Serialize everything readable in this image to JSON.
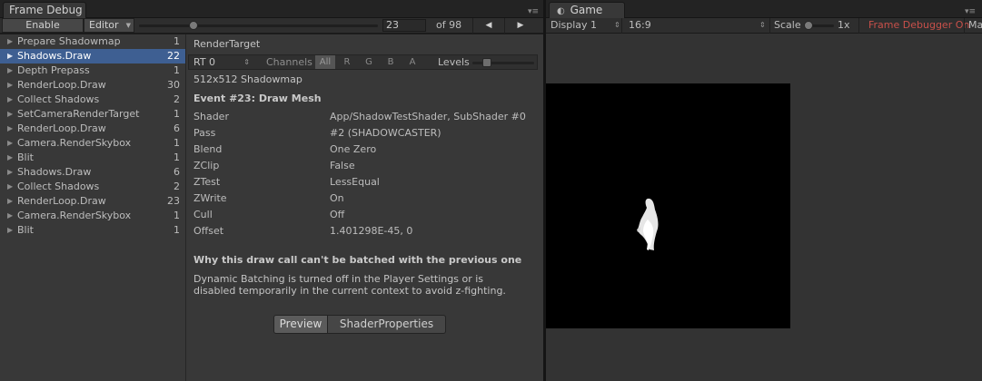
{
  "frame_debug": {
    "tab_title": "Frame Debug",
    "toolbar": {
      "enable_label": "Enable",
      "target_label": "Editor",
      "current_event": "23",
      "event_total": "of 98"
    },
    "events": [
      {
        "label": "Prepare Shadowmap",
        "count": "1"
      },
      {
        "label": "Shadows.Draw",
        "count": "22"
      },
      {
        "label": "Depth Prepass",
        "count": "1"
      },
      {
        "label": "RenderLoop.Draw",
        "count": "30"
      },
      {
        "label": "Collect Shadows",
        "count": "2"
      },
      {
        "label": "SetCameraRenderTarget",
        "count": "1"
      },
      {
        "label": "RenderLoop.Draw",
        "count": "6"
      },
      {
        "label": "Camera.RenderSkybox",
        "count": "1"
      },
      {
        "label": "Blit",
        "count": "1"
      },
      {
        "label": "Shadows.Draw",
        "count": "6"
      },
      {
        "label": "Collect Shadows",
        "count": "2"
      },
      {
        "label": "RenderLoop.Draw",
        "count": "23"
      },
      {
        "label": "Camera.RenderSkybox",
        "count": "1"
      },
      {
        "label": "Blit",
        "count": "1"
      }
    ],
    "details": {
      "render_target_heading": "RenderTarget",
      "rt_select": "RT 0",
      "channels_label": "Channels",
      "channel_buttons": [
        "All",
        "R",
        "G",
        "B",
        "A"
      ],
      "levels_label": "Levels",
      "rt_size": "512x512 Shadowmap",
      "event_heading": "Event #23: Draw Mesh",
      "properties": [
        {
          "key": "Shader",
          "value": "App/ShadowTestShader, SubShader #0"
        },
        {
          "key": "Pass",
          "value": "#2 (SHADOWCASTER)"
        },
        {
          "key": "Blend",
          "value": "One Zero"
        },
        {
          "key": "ZClip",
          "value": "False"
        },
        {
          "key": "ZTest",
          "value": "LessEqual"
        },
        {
          "key": "ZWrite",
          "value": "On"
        },
        {
          "key": "Cull",
          "value": "Off"
        },
        {
          "key": "Offset",
          "value": "1.401298E-45, 0"
        }
      ],
      "batch_heading": "Why this draw call can't be batched with the previous one",
      "batch_reason_line1": "Dynamic Batching is turned off in the Player Settings or is",
      "batch_reason_line2": "disabled temporarily in the current context to avoid z-fighting.",
      "tabs": [
        "Preview",
        "ShaderProperties"
      ]
    }
  },
  "game": {
    "tab_title": "Game",
    "display": "Display 1",
    "aspect": "16:9",
    "scale_label": "Scale",
    "scale_value": "1x",
    "frame_debugger_status": "Frame Debugger On",
    "maximize_label": "Ma"
  },
  "colors": {
    "selection": "#3e5f92",
    "frame_debugger_on": "#c8504a"
  }
}
